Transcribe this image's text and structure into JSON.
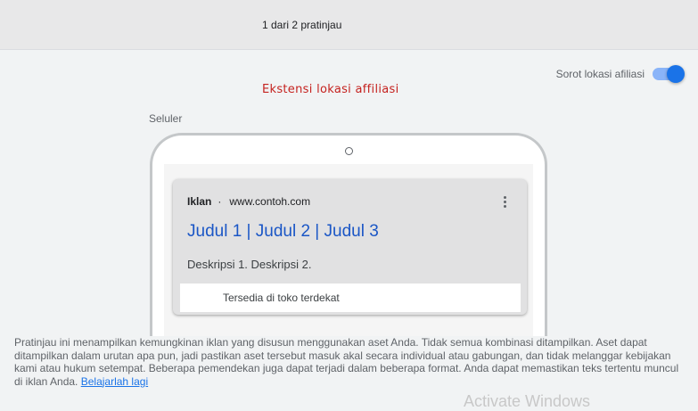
{
  "header": {
    "preview_count": "1 dari 2 pratinjau"
  },
  "toggle": {
    "label": "Sorot lokasi afiliasi",
    "on": true
  },
  "annotation": {
    "label": "Ekstensi lokasi affiliasi"
  },
  "device": {
    "label": "Seluler"
  },
  "ad": {
    "badge": "Iklan",
    "separator": "·",
    "url": "www.contoh.com",
    "title": "Judul 1 | Judul 2 | Judul 3",
    "description": "Deskripsi 1. Deskripsi 2.",
    "extension": "Tersedia di toko terdekat"
  },
  "footer": {
    "text": "Pratinjau ini menampilkan kemungkinan iklan yang disusun menggunakan aset Anda. Tidak semua kombinasi ditampilkan. Aset dapat ditampilkan dalam urutan apa pun, jadi pastikan aset tersebut masuk akal secara individual atau gabungan, dan tidak melanggar kebijakan kami atau hukum setempat. Beberapa pemendekan juga dapat terjadi dalam beberapa format. Anda dapat memastikan teks tertentu muncul di iklan Anda.",
    "link": "Belajarlah lagi"
  },
  "watermark": {
    "text": "Activate Windows"
  },
  "colors": {
    "accent": "#1a73e8",
    "annotation": "#c5221f",
    "ad_title": "#1a56c6"
  }
}
